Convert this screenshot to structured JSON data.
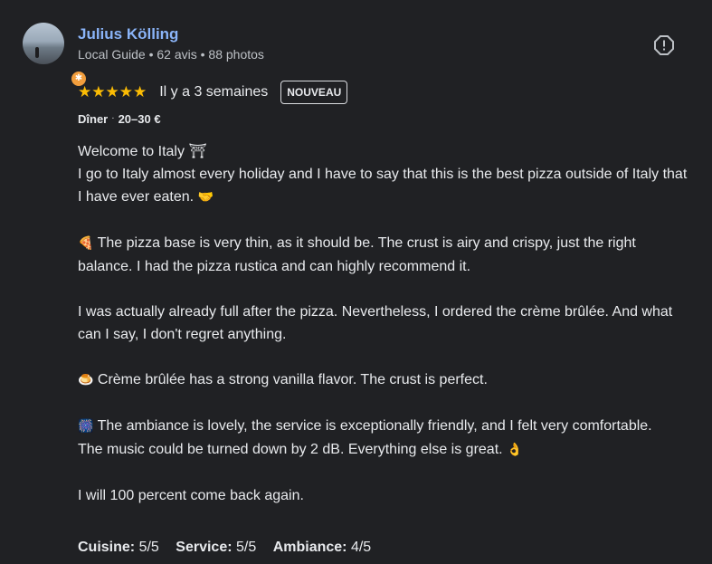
{
  "reviewer": {
    "name": "Julius Kölling",
    "meta": "Local Guide • 62 avis • 88 photos",
    "badge_icon": "local-guide-star-icon"
  },
  "rating": {
    "stars": "★★★★★",
    "date": "Il y a 3 semaines",
    "badge": "NOUVEAU"
  },
  "details": {
    "meal": "Dîner",
    "separator": "·",
    "price": "20–30 €"
  },
  "review": {
    "line1": "Welcome to Italy ⛩",
    "line2": "I go to Italy almost every holiday and I have to say that this is the best pizza outside of Italy that I have ever eaten.",
    "line2_emoji": "🤝",
    "p2_emoji": "🍕",
    "p2": "The pizza base is very thin, as it should be. The crust is airy and crispy, just the right balance. I had the pizza rustica and can highly recommend it.",
    "p3": "I was actually already full after the pizza. Nevertheless, I ordered the crème brûlée. And what can I say, I don't regret anything.",
    "p4_emoji": "🍮",
    "p4": "Crème brûlée has a strong vanilla flavor. The crust is perfect.",
    "p5_emoji": "🎆",
    "p5": "The ambiance is lovely, the service is exceptionally friendly, and I felt very comfortable.",
    "p5b": "The music could be turned down by 2 dB. Everything else is great.",
    "p5b_emoji": "👌",
    "p6": "I will 100 percent come back again."
  },
  "scores": [
    {
      "label": "Cuisine:",
      "value": "5/5"
    },
    {
      "label": "Service:",
      "value": "5/5"
    },
    {
      "label": "Ambiance:",
      "value": "4/5"
    }
  ],
  "colors": {
    "background": "#202124",
    "name": "#8ab4f8",
    "stars": "#fbbc04",
    "text": "#e8eaed"
  }
}
